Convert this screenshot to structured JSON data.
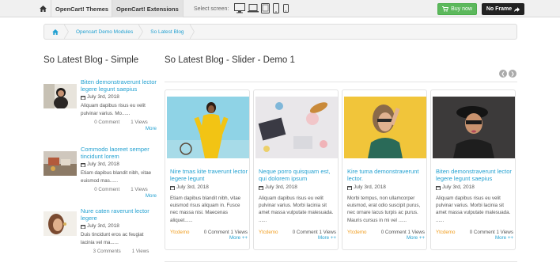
{
  "topbar": {
    "tabs": [
      "OpenCart! Themes",
      "OpenCart! Extensions"
    ],
    "select_screen": "Select screen:",
    "buy_label": "Buy now",
    "noframe_label": "No Frame",
    "devices": [
      "desktop-icon",
      "laptop-icon",
      "tablet-icon",
      "phone-icon",
      "phone-small-icon"
    ]
  },
  "breadcrumb": [
    "Opencart Demo Modules",
    "So Latest Blog"
  ],
  "left": {
    "heading": "So Latest Blog - Simple",
    "items": [
      {
        "title": "Biten demonstraverunt lector legere legunt saepius",
        "date": "July 3rd, 2018",
        "desc": "Aliquam dapibus risus eu velit pulvinar varius. Mo......",
        "comments": "0 Comment",
        "views": "1 Views",
        "more": "More"
      },
      {
        "title": "Commodo laoreet semper tincidunt lorem",
        "date": "July 3rd, 2018",
        "desc": "Etiam dapibus blandit nibh, vitae euismod mas......",
        "comments": "0 Comment",
        "views": "1 Views",
        "more": "More"
      },
      {
        "title": "Nure caten raverunt lector legere",
        "date": "July 3rd, 2018",
        "desc": "Duis tincidunt eros ac feugiat lacinia vel ma......",
        "comments": "3 Comments",
        "views": "1 Views",
        "more": ""
      }
    ]
  },
  "main": {
    "heading": "So Latest Blog - Slider - Demo 1",
    "cards": [
      {
        "title": "Nire tmas kite traverunt lector legere legunt",
        "date": "July 3rd, 2018",
        "desc": "Etiam dapibus blandit nibh, vitae euismod risus aliquam in. Fusce nec massa nisi. Maecenas aliquet......",
        "author": "Ytcdemo",
        "comments": "0 Comment",
        "views": "1 Views",
        "more": "More ++"
      },
      {
        "title": "Neque porro quisquam est, qui dolorem ipsum",
        "date": "July 3rd, 2018",
        "desc": "Aliquam dapibus risus eu velit pulvinar varius. Morbi lacinia sit amet massa vulputate malesuada. ......",
        "author": "Ytcdemo",
        "comments": "0 Comment",
        "views": "1 Views",
        "more": "More ++"
      },
      {
        "title": "Kire tuma demonstraverunt lector.",
        "date": "July 3rd, 2018",
        "desc": "Morbi tempus, non ullamcorper euismod, erat odio suscipit purus, nec ornare lacus turpis ac purus. Mauris cursus in mi vel ......",
        "author": "Ytcdemo",
        "comments": "0 Comment",
        "views": "1 Views",
        "more": "More ++"
      },
      {
        "title": "Biten demonstraverunt lector legere legunt saepius",
        "date": "July 3rd, 2018",
        "desc": "Aliquam dapibus risus eu velit pulvinar varius. Morbi lacinia sit amet massa vulputate malesuada. ......",
        "author": "Ytcdemo",
        "comments": "0 Comment",
        "views": "1 Views",
        "more": "More ++"
      }
    ]
  },
  "colors": {
    "link": "#23a1d1",
    "buy": "#5cb85c",
    "noframe": "#222222",
    "author": "#f09b1a"
  }
}
